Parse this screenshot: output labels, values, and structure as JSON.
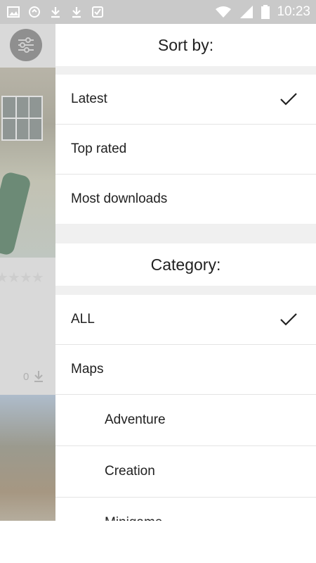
{
  "status_bar": {
    "time": "10:23",
    "left_icons": [
      "image-icon",
      "sync-icon",
      "download-icon",
      "download-icon",
      "check-icon"
    ],
    "right_icons": [
      "wifi-icon",
      "signal-icon",
      "battery-icon"
    ]
  },
  "background": {
    "stars": "★★★★",
    "download_count": "0"
  },
  "drawer": {
    "sort_header": "Sort by:",
    "sort_options": [
      {
        "label": "Latest",
        "selected": true
      },
      {
        "label": "Top rated",
        "selected": false
      },
      {
        "label": "Most downloads",
        "selected": false
      }
    ],
    "category_header": "Category:",
    "categories": [
      {
        "label": "ALL",
        "selected": true,
        "level": 0
      },
      {
        "label": "Maps",
        "selected": false,
        "level": 0
      },
      {
        "label": "Adventure",
        "selected": false,
        "level": 1
      },
      {
        "label": "Creation",
        "selected": false,
        "level": 1
      },
      {
        "label": "Minigame",
        "selected": false,
        "level": 1
      }
    ]
  },
  "colors": {
    "status_bar": "#c9c9c9",
    "scrim": "#d9d9d9",
    "section_gap": "#f0f0f0",
    "text": "#212121"
  }
}
